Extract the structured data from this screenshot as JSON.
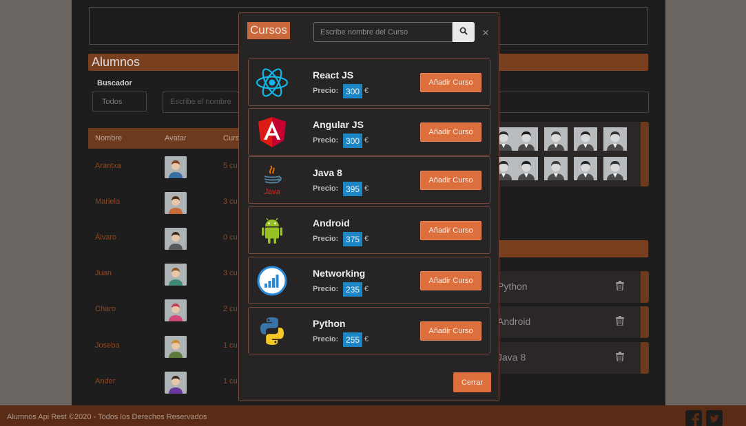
{
  "background": {
    "top_panel": "",
    "students_section_title": "Alumnos",
    "search_label": "Buscador",
    "filter_value": "Todos",
    "search_placeholder": "Escribe el nombre",
    "table_headers": [
      "Nombre",
      "Avatar",
      "Curs"
    ],
    "rows": [
      {
        "name": "Arantxa",
        "courses": "5 cu"
      },
      {
        "name": "Mariela",
        "courses": "3 cu"
      },
      {
        "name": "Álvaro",
        "courses": "0 cu"
      },
      {
        "name": "Juan",
        "courses": "3 cu"
      },
      {
        "name": "Charo",
        "courses": "2 cu"
      },
      {
        "name": "Joseba",
        "courses": "1 cu"
      },
      {
        "name": "Ander",
        "courses": "1 cu"
      }
    ],
    "assigned_courses": [
      "Python",
      "Android",
      "Java 8"
    ]
  },
  "modal": {
    "title": "Cursos",
    "search_placeholder": "Escribe nombre del Curso",
    "close_symbol": "×",
    "price_label": "Precio:",
    "currency": "€",
    "add_button_label": "Añadir Curso",
    "footer_button_label": "Cerrar",
    "courses": [
      {
        "name": "React JS",
        "price": "300",
        "icon": "react-logo-icon"
      },
      {
        "name": "Angular JS",
        "price": "300",
        "icon": "angular-logo-icon"
      },
      {
        "name": "Java 8",
        "price": "395",
        "icon": "java-logo-icon"
      },
      {
        "name": "Android",
        "price": "375",
        "icon": "android-logo-icon"
      },
      {
        "name": "Networking",
        "price": "235",
        "icon": "networking-chart-icon"
      },
      {
        "name": "Python",
        "price": "255",
        "icon": "python-logo-icon"
      }
    ],
    "java_logo_text": "Java"
  },
  "footer": {
    "copyright": "Alumnos Api Rest ©2020 - Todos los Derechos Reservados"
  },
  "colors": {
    "accent": "#dd6f3d",
    "price_badge": "#1e86c4",
    "overlay_bar": "#7a3f1f"
  }
}
